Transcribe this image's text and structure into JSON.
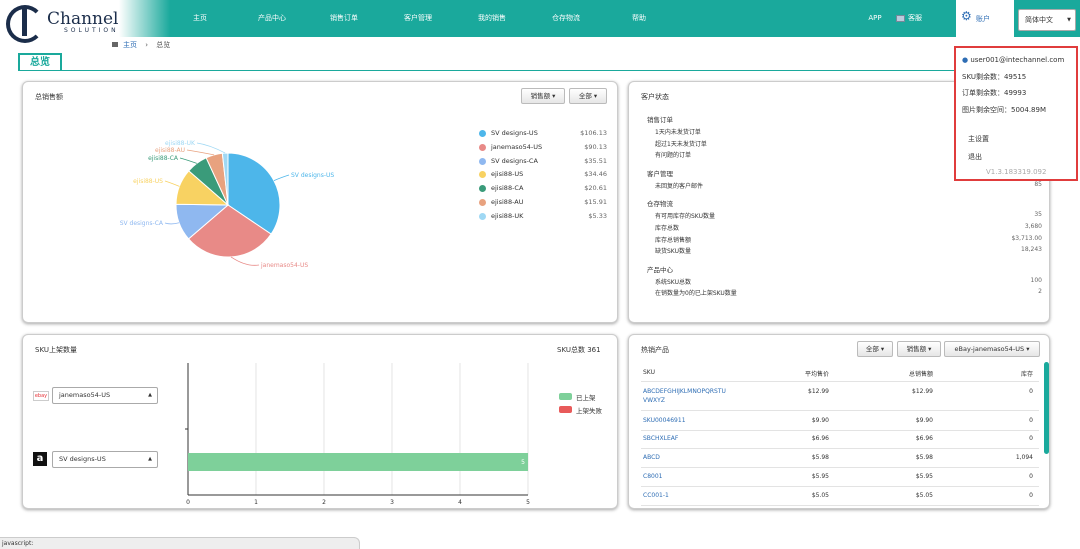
{
  "brand": {
    "logo_text": "Channel",
    "logo_sub": "SOLUTION"
  },
  "nav": {
    "items": [
      "主页",
      "产品中心",
      "销售订单",
      "客户管理",
      "我的销售",
      "仓存物流",
      "帮助"
    ],
    "app": "APP",
    "service": "客服",
    "account": "账户",
    "language": "简体中文"
  },
  "breadcrumb": {
    "home": "主页",
    "sep": "›",
    "current": "总览"
  },
  "page_title": "总览",
  "sales_panel": {
    "title": "总销售额",
    "btn_metric": "销售额 ▾",
    "btn_range": "全部 ▾",
    "legend": [
      {
        "name": "SV designs-US",
        "value": "$106.13",
        "color": "#4db6ea"
      },
      {
        "name": "janemaso54-US",
        "value": "$90.13",
        "color": "#e88a87"
      },
      {
        "name": "SV designs-CA",
        "value": "$35.51",
        "color": "#8fb8f0"
      },
      {
        "name": "ejisi88-US",
        "value": "$34.46",
        "color": "#f8d262"
      },
      {
        "name": "ejisi88-CA",
        "value": "$20.61",
        "color": "#3a9b7a"
      },
      {
        "name": "ejisi88-AU",
        "value": "$15.91",
        "color": "#e8a27f"
      },
      {
        "name": "ejisi88-UK",
        "value": "$5.33",
        "color": "#9fd8f4"
      }
    ]
  },
  "chart_data": [
    {
      "type": "pie",
      "title": "总销售额",
      "labels": [
        "SV designs-US",
        "janemaso54-US",
        "SV designs-CA",
        "ejisi88-US",
        "ejisi88-CA",
        "ejisi88-AU",
        "ejisi88-UK"
      ],
      "values": [
        106.13,
        90.13,
        35.51,
        34.46,
        20.61,
        15.91,
        5.33
      ],
      "colors": [
        "#4db6ea",
        "#e88a87",
        "#8fb8f0",
        "#f8d262",
        "#3a9b7a",
        "#e8a27f",
        "#9fd8f4"
      ]
    },
    {
      "type": "bar",
      "orientation": "horizontal",
      "title": "SKU上架数量",
      "categories": [
        "janemaso54-US",
        "SV designs-US"
      ],
      "series": [
        {
          "name": "已上架",
          "values": [
            0,
            5
          ],
          "color": "#7ed09a"
        },
        {
          "name": "上架失败",
          "values": [
            0,
            0
          ],
          "color": "#e85a5a"
        }
      ],
      "xlim": [
        0,
        5
      ],
      "xticks": [
        "0",
        "1",
        "2",
        "3",
        "4",
        "5"
      ]
    }
  ],
  "customer_panel": {
    "title": "客户状态",
    "sections": [
      {
        "heading": "销售订单",
        "items": [
          {
            "label": "1天内未发货订单",
            "value": ""
          },
          {
            "label": "超过1天未发货订单",
            "value": ""
          },
          {
            "label": "有问题的订单",
            "value": ""
          }
        ]
      },
      {
        "heading": "客户管理",
        "items": [
          {
            "label": "未回复的客户邮件",
            "value": "85"
          }
        ]
      },
      {
        "heading": "仓存物流",
        "items": [
          {
            "label": "有可用库存的SKU数量",
            "value": "35"
          },
          {
            "label": "库存总数",
            "value": "3,680"
          },
          {
            "label": "库存总销售额",
            "value": "$3,713.00"
          },
          {
            "label": "缺货SKU数量",
            "value": "18,243"
          }
        ]
      },
      {
        "heading": "产品中心",
        "items": [
          {
            "label": "系统SKU总数",
            "value": "100"
          },
          {
            "label": "在销数量为0的已上架SKU数量",
            "value": "2"
          }
        ]
      }
    ]
  },
  "account_popup": {
    "email": "user001@intechannel.com",
    "sku_left": "SKU剩余数：49515",
    "orders_left": "订单剩余数：49993",
    "image_space": "图片剩余空间：5004.89M",
    "settings": "主设置",
    "logout": "退出",
    "version": "V1.3.183319.092"
  },
  "sku_panel": {
    "title": "SKU上架数量",
    "total": "SKU总数 361",
    "store1": "janemaso54-US",
    "store2": "SV designs-US",
    "bar_label": "5",
    "legend_listed": "已上架",
    "legend_failed": "上架失败",
    "xticks": [
      "0",
      "1",
      "2",
      "3",
      "4",
      "5"
    ]
  },
  "hot_panel": {
    "title": "热销产品",
    "btn_range": "全部 ▾",
    "btn_metric": "销售额 ▾",
    "btn_store": "eBay-janemaso54-US ▾",
    "headers": [
      "SKU",
      "平均售价",
      "总销售额",
      "库存"
    ],
    "rows": [
      {
        "sku": "ABCDEFGHIJKLMNOPQRSTU",
        "sku2": "VWXYZ",
        "avg": "$12.99",
        "total": "$12.99",
        "stock": "0"
      },
      {
        "sku": "SKU00046911",
        "sku2": "",
        "avg": "$9.90",
        "total": "$9.90",
        "stock": "0"
      },
      {
        "sku": "SBCHXLEAF",
        "sku2": "",
        "avg": "$6.96",
        "total": "$6.96",
        "stock": "0"
      },
      {
        "sku": "ABCD",
        "sku2": "",
        "avg": "$5.98",
        "total": "$5.98",
        "stock": "1,094"
      },
      {
        "sku": "C8001",
        "sku2": "",
        "avg": "$5.95",
        "total": "$5.95",
        "stock": "0"
      },
      {
        "sku": "CC001-1",
        "sku2": "",
        "avg": "$5.05",
        "total": "$5.05",
        "stock": "0"
      }
    ]
  },
  "status_bar": "javascript:"
}
